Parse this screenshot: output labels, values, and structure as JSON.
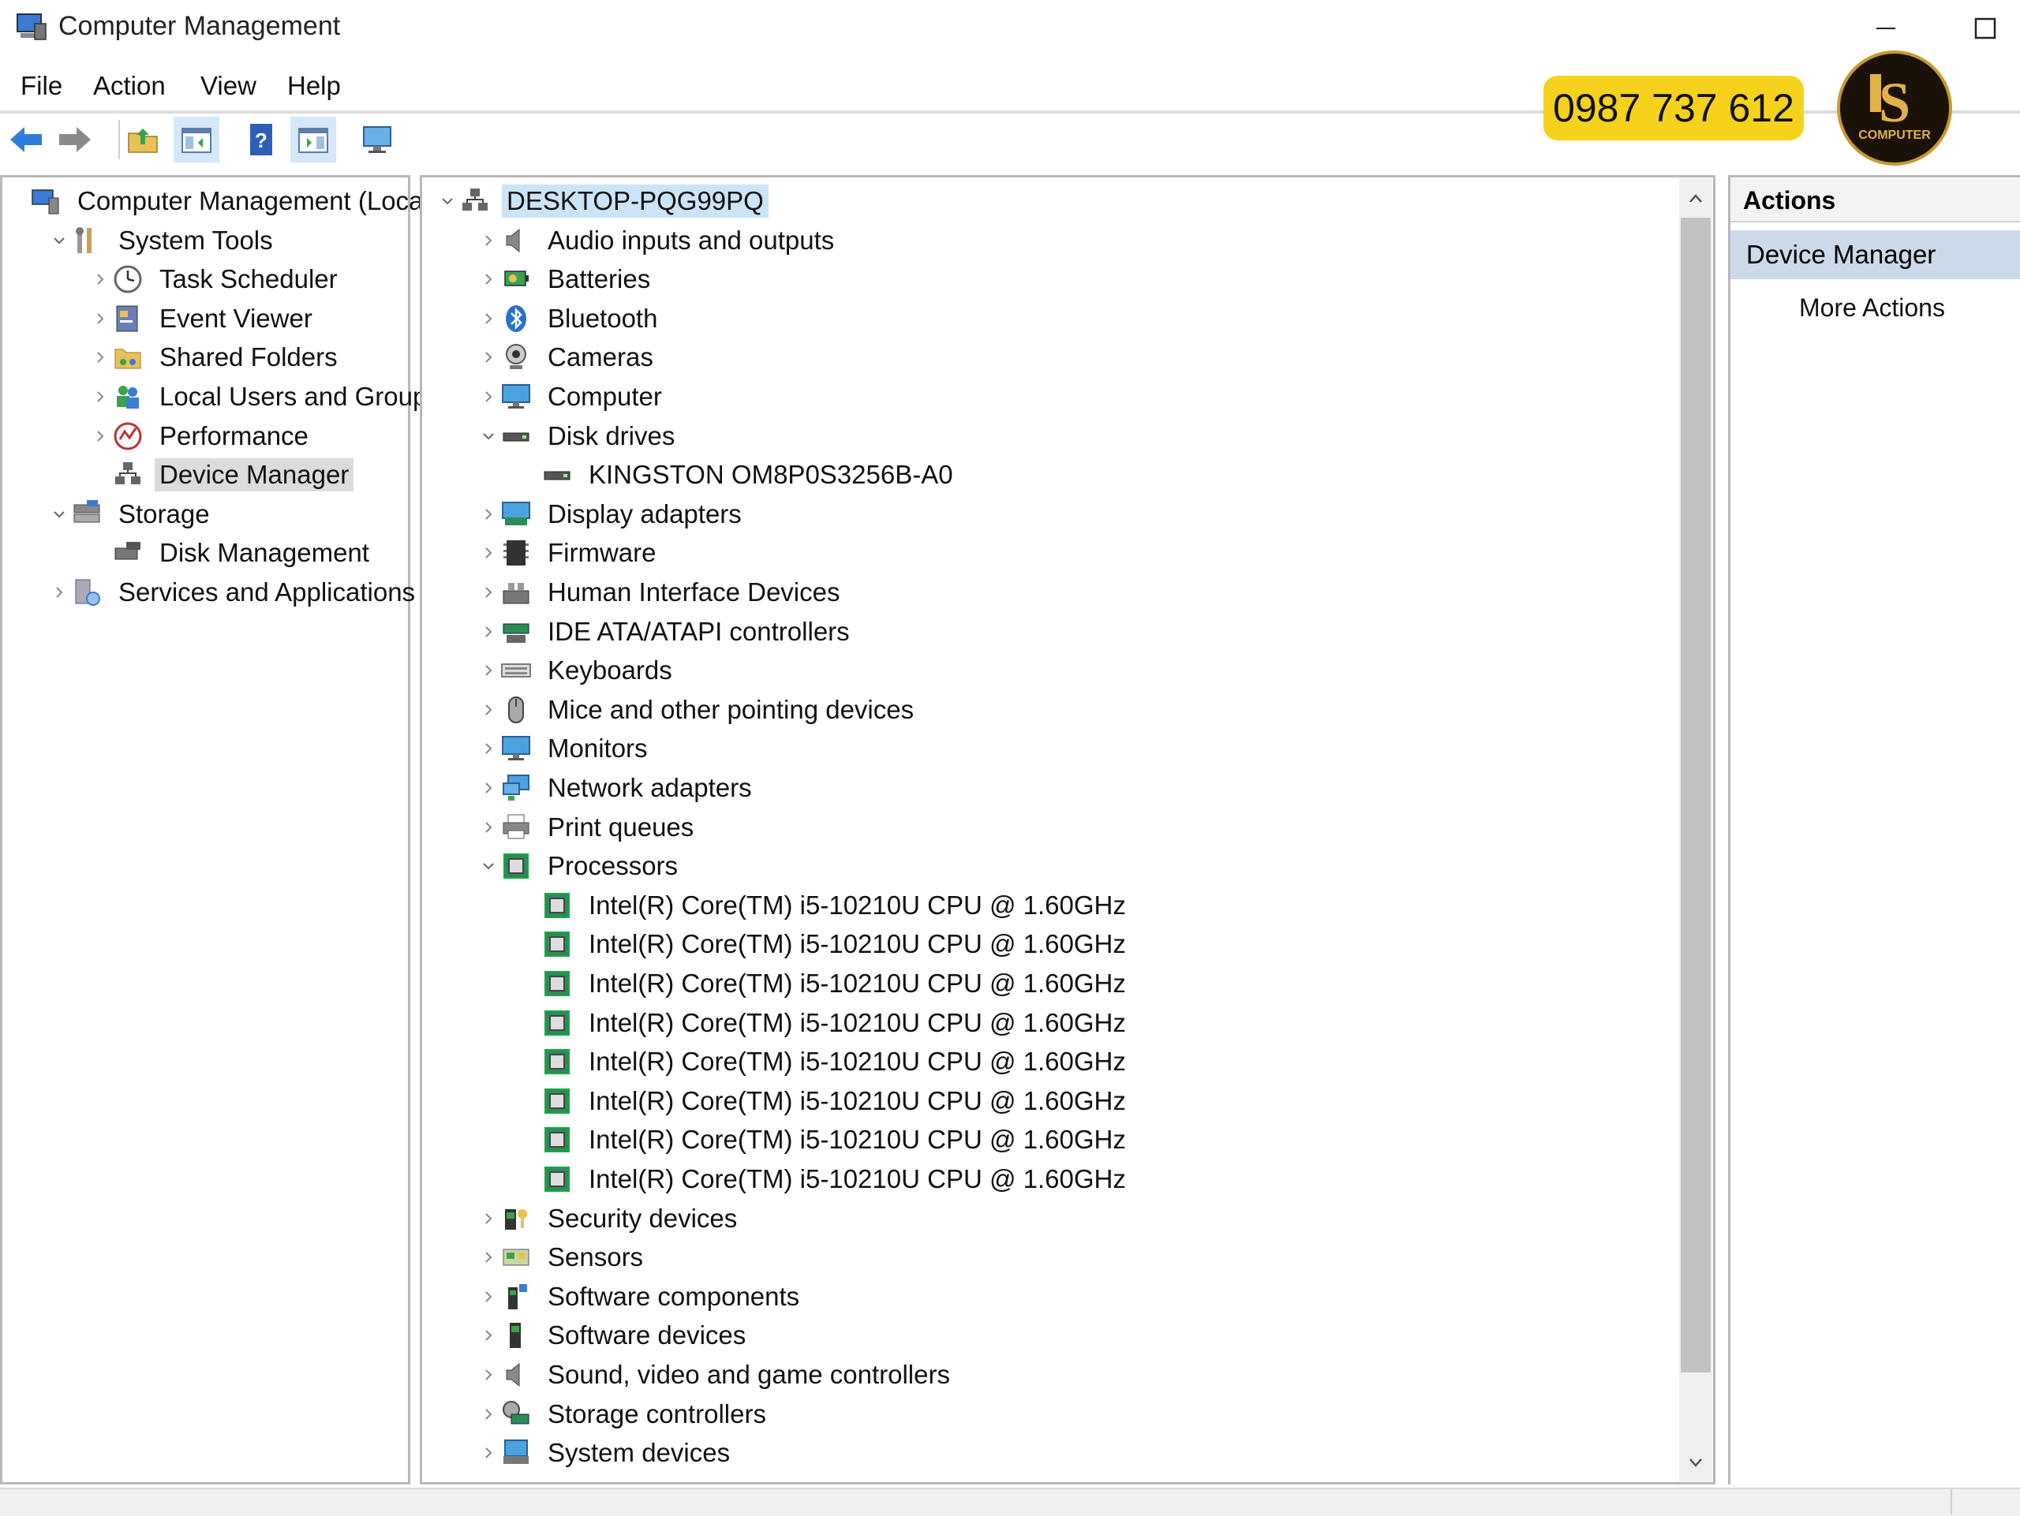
{
  "window": {
    "title": "Computer Management"
  },
  "menu": [
    "File",
    "Action",
    "View",
    "Help"
  ],
  "overlay": {
    "phone": "0987 737 612",
    "logo_text": "COMPUTER"
  },
  "left_tree": [
    {
      "label": "Computer Management (Local)",
      "level": 0,
      "chevron": "",
      "icon": "computer-management-icon"
    },
    {
      "label": "System Tools",
      "level": 1,
      "chevron": "down",
      "icon": "system-tools-icon"
    },
    {
      "label": "Task Scheduler",
      "level": 2,
      "chevron": "right",
      "icon": "clock-icon"
    },
    {
      "label": "Event Viewer",
      "level": 2,
      "chevron": "right",
      "icon": "event-viewer-icon"
    },
    {
      "label": "Shared Folders",
      "level": 2,
      "chevron": "right",
      "icon": "shared-folder-icon"
    },
    {
      "label": "Local Users and Groups",
      "level": 2,
      "chevron": "right",
      "icon": "users-icon"
    },
    {
      "label": "Performance",
      "level": 2,
      "chevron": "right",
      "icon": "performance-icon"
    },
    {
      "label": "Device Manager",
      "level": 2,
      "chevron": "",
      "icon": "device-manager-icon",
      "selected": true
    },
    {
      "label": "Storage",
      "level": 1,
      "chevron": "down",
      "icon": "storage-icon"
    },
    {
      "label": "Disk Management",
      "level": 2,
      "chevron": "",
      "icon": "disk-management-icon"
    },
    {
      "label": "Services and Applications",
      "level": 1,
      "chevron": "right",
      "icon": "services-icon"
    }
  ],
  "device_tree": [
    {
      "label": "DESKTOP-PQG99PQ",
      "level": 0,
      "chevron": "down",
      "icon": "desktop-icon",
      "selected": true
    },
    {
      "label": "Audio inputs and outputs",
      "level": 1,
      "chevron": "right",
      "icon": "speaker-icon"
    },
    {
      "label": "Batteries",
      "level": 1,
      "chevron": "right",
      "icon": "battery-icon"
    },
    {
      "label": "Bluetooth",
      "level": 1,
      "chevron": "right",
      "icon": "bluetooth-icon"
    },
    {
      "label": "Cameras",
      "level": 1,
      "chevron": "right",
      "icon": "camera-icon"
    },
    {
      "label": "Computer",
      "level": 1,
      "chevron": "right",
      "icon": "monitor-icon"
    },
    {
      "label": "Disk drives",
      "level": 1,
      "chevron": "down",
      "icon": "disk-icon"
    },
    {
      "label": "KINGSTON OM8P0S3256B-A0",
      "level": 2,
      "chevron": "",
      "icon": "disk-icon"
    },
    {
      "label": "Display adapters",
      "level": 1,
      "chevron": "right",
      "icon": "display-adapter-icon"
    },
    {
      "label": "Firmware",
      "level": 1,
      "chevron": "right",
      "icon": "firmware-icon"
    },
    {
      "label": "Human Interface Devices",
      "level": 1,
      "chevron": "right",
      "icon": "hid-icon"
    },
    {
      "label": "IDE ATA/ATAPI controllers",
      "level": 1,
      "chevron": "right",
      "icon": "ide-icon"
    },
    {
      "label": "Keyboards",
      "level": 1,
      "chevron": "right",
      "icon": "keyboard-icon"
    },
    {
      "label": "Mice and other pointing devices",
      "level": 1,
      "chevron": "right",
      "icon": "mouse-icon"
    },
    {
      "label": "Monitors",
      "level": 1,
      "chevron": "right",
      "icon": "monitor-icon"
    },
    {
      "label": "Network adapters",
      "level": 1,
      "chevron": "right",
      "icon": "network-icon"
    },
    {
      "label": "Print queues",
      "level": 1,
      "chevron": "right",
      "icon": "printer-icon"
    },
    {
      "label": "Processors",
      "level": 1,
      "chevron": "down",
      "icon": "processor-icon"
    },
    {
      "label": "Intel(R) Core(TM) i5-10210U CPU @ 1.60GHz",
      "level": 2,
      "chevron": "",
      "icon": "processor-icon"
    },
    {
      "label": "Intel(R) Core(TM) i5-10210U CPU @ 1.60GHz",
      "level": 2,
      "chevron": "",
      "icon": "processor-icon"
    },
    {
      "label": "Intel(R) Core(TM) i5-10210U CPU @ 1.60GHz",
      "level": 2,
      "chevron": "",
      "icon": "processor-icon"
    },
    {
      "label": "Intel(R) Core(TM) i5-10210U CPU @ 1.60GHz",
      "level": 2,
      "chevron": "",
      "icon": "processor-icon"
    },
    {
      "label": "Intel(R) Core(TM) i5-10210U CPU @ 1.60GHz",
      "level": 2,
      "chevron": "",
      "icon": "processor-icon"
    },
    {
      "label": "Intel(R) Core(TM) i5-10210U CPU @ 1.60GHz",
      "level": 2,
      "chevron": "",
      "icon": "processor-icon"
    },
    {
      "label": "Intel(R) Core(TM) i5-10210U CPU @ 1.60GHz",
      "level": 2,
      "chevron": "",
      "icon": "processor-icon"
    },
    {
      "label": "Intel(R) Core(TM) i5-10210U CPU @ 1.60GHz",
      "level": 2,
      "chevron": "",
      "icon": "processor-icon"
    },
    {
      "label": "Security devices",
      "level": 1,
      "chevron": "right",
      "icon": "security-icon"
    },
    {
      "label": "Sensors",
      "level": 1,
      "chevron": "right",
      "icon": "sensor-icon"
    },
    {
      "label": "Software components",
      "level": 1,
      "chevron": "right",
      "icon": "software-component-icon"
    },
    {
      "label": "Software devices",
      "level": 1,
      "chevron": "right",
      "icon": "software-device-icon"
    },
    {
      "label": "Sound, video and game controllers",
      "level": 1,
      "chevron": "right",
      "icon": "speaker-icon"
    },
    {
      "label": "Storage controllers",
      "level": 1,
      "chevron": "right",
      "icon": "storage-controller-icon"
    },
    {
      "label": "System devices",
      "level": 1,
      "chevron": "right",
      "icon": "system-device-icon"
    }
  ],
  "actions": {
    "header": "Actions",
    "selected": "Device Manager",
    "more": "More Actions"
  },
  "colors": {
    "selection_blue": "#cce4f7",
    "selection_gray": "#dcdcdc",
    "actions_highlight": "#cbd9ea",
    "phone_badge": "#f7d21c"
  }
}
